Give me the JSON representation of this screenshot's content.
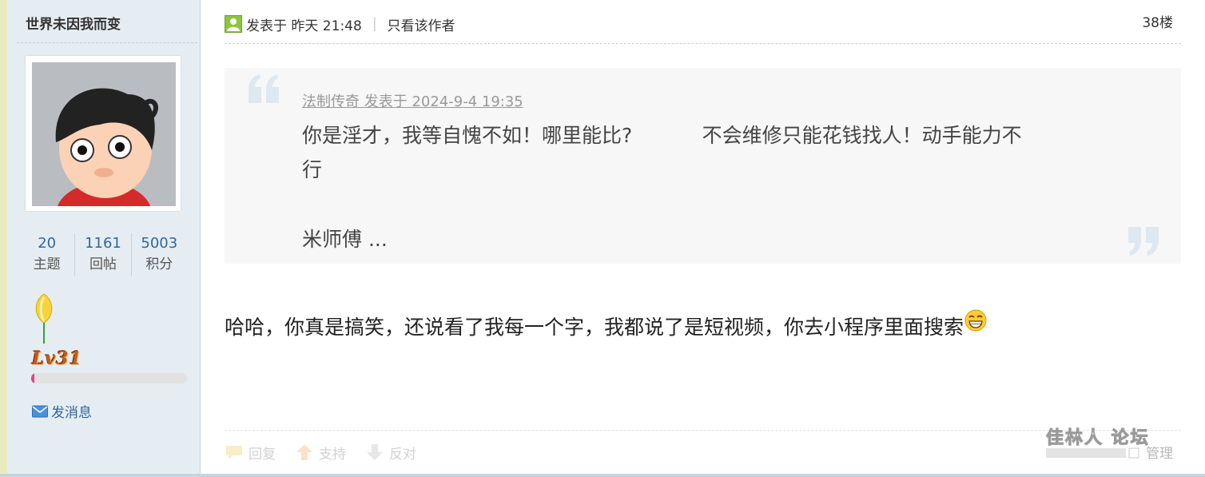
{
  "user": {
    "name": "世界未因我而变",
    "stats": [
      {
        "value": "20",
        "label": "主题"
      },
      {
        "value": "1161",
        "label": "回帖"
      },
      {
        "value": "5003",
        "label": "积分"
      }
    ],
    "level": "Lv31",
    "level_progress": 0.02,
    "send_message_label": "发消息"
  },
  "post": {
    "posted_text": "发表于 昨天 21:48",
    "only_author_label": "只看该作者",
    "floor": "38楼",
    "quote": {
      "meta": "法制传奇 发表于 2024-9-4 19:35",
      "line1": "你是淫才，我等自愧不如！哪里能比?           不会维修只能花钱找人！动手能力不",
      "line2": "行",
      "line3": "米师傅 ..."
    },
    "body": "哈哈，你真是搞笑，还说看了我每一个字，我都说了是短视频，你去小程序里面搜索",
    "actions": {
      "reply": "回复",
      "support": "支持",
      "oppose": "反对",
      "manage": "管理"
    }
  },
  "watermark": {
    "text": "佳林人 论坛"
  },
  "colors": {
    "sidebar_bg": "#e5edf2",
    "link_blue": "#336699",
    "quote_bg": "#f7f7f7",
    "level_fill": "#e0448a"
  },
  "icons": {
    "online": "online-status-icon",
    "message": "envelope-icon",
    "reply": "reply-bubble-icon",
    "support": "thumbs-up-arrow-icon",
    "oppose": "thumbs-down-arrow-icon",
    "emoji": "grin-emoji-icon"
  }
}
